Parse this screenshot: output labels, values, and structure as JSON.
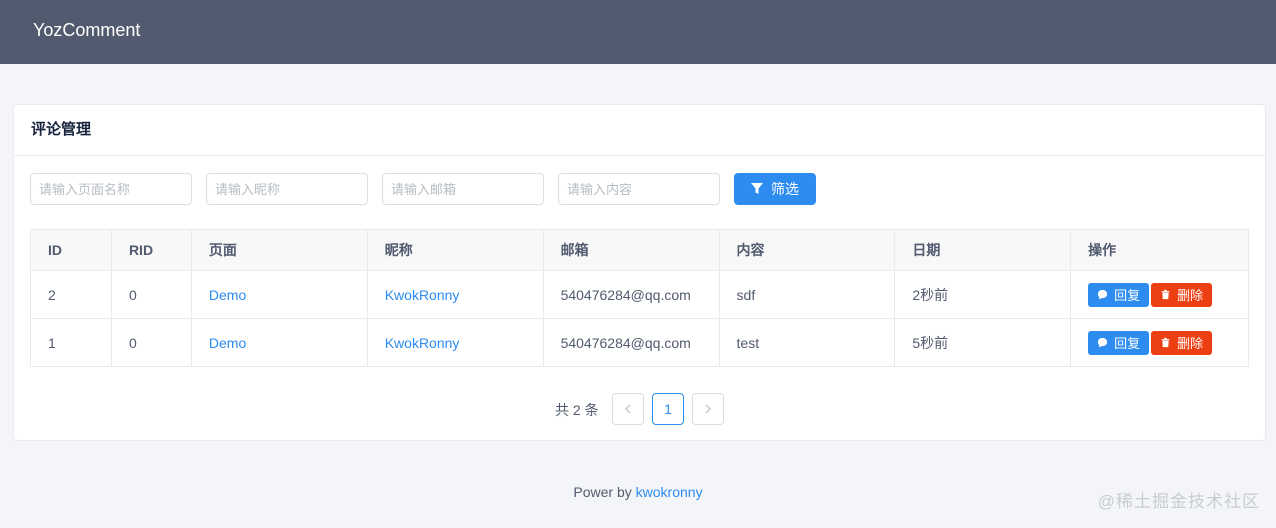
{
  "app": {
    "title": "YozComment"
  },
  "card": {
    "title": "评论管理"
  },
  "filters": {
    "page_placeholder": "请输入页面名称",
    "nickname_placeholder": "请输入昵称",
    "email_placeholder": "请输入邮箱",
    "content_placeholder": "请输入内容",
    "filter_label": "筛选"
  },
  "table": {
    "columns": [
      "ID",
      "RID",
      "页面",
      "昵称",
      "邮箱",
      "内容",
      "日期",
      "操作"
    ],
    "rows": [
      {
        "id": "2",
        "rid": "0",
        "page": "Demo",
        "nickname": "KwokRonny",
        "email": "540476284@qq.com",
        "content": "sdf",
        "date": "2秒前"
      },
      {
        "id": "1",
        "rid": "0",
        "page": "Demo",
        "nickname": "KwokRonny",
        "email": "540476284@qq.com",
        "content": "test",
        "date": "5秒前"
      }
    ],
    "reply_label": "回复",
    "delete_label": "删除"
  },
  "pagination": {
    "total_text": "共 2 条",
    "current_page": "1",
    "prev_icon": "chevron-left-icon",
    "next_icon": "chevron-right-icon"
  },
  "footer": {
    "prefix": "Power by",
    "link": "kwokronny"
  },
  "watermark": "@稀土掘金技术社区",
  "colors": {
    "header": "#515a6e",
    "primary": "#2d8cf0",
    "danger": "#ed3f14",
    "background": "#f4f5f8"
  }
}
